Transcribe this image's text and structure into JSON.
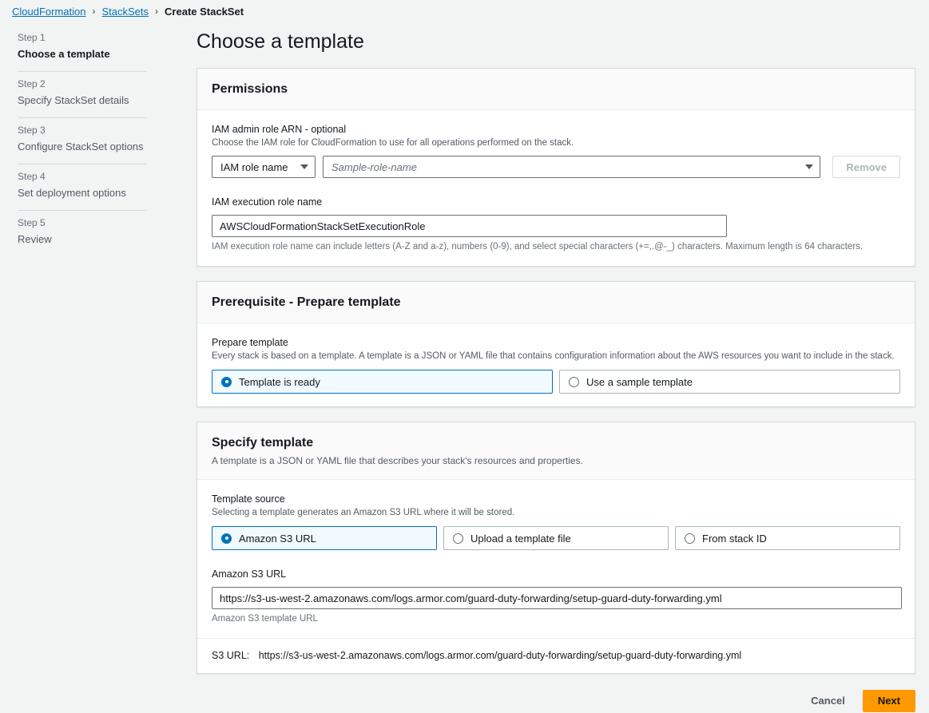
{
  "breadcrumb": {
    "items": [
      {
        "label": "CloudFormation",
        "type": "link"
      },
      {
        "label": "StackSets",
        "type": "link"
      },
      {
        "label": "Create StackSet",
        "type": "current"
      }
    ],
    "separator": "›"
  },
  "sidebar": {
    "steps": [
      {
        "num": "Step 1",
        "title": "Choose a template",
        "active": true
      },
      {
        "num": "Step 2",
        "title": "Specify StackSet details",
        "active": false
      },
      {
        "num": "Step 3",
        "title": "Configure StackSet options",
        "active": false
      },
      {
        "num": "Step 4",
        "title": "Set deployment options",
        "active": false
      },
      {
        "num": "Step 5",
        "title": "Review",
        "active": false
      }
    ]
  },
  "page": {
    "title": "Choose a template"
  },
  "permissions": {
    "header": "Permissions",
    "admin_role": {
      "label": "IAM admin role ARN - optional",
      "description": "Choose the IAM role for CloudFormation to use for all operations performed on the stack.",
      "select_value": "IAM role name",
      "combo_placeholder": "Sample-role-name",
      "combo_value": "",
      "remove_label": "Remove"
    },
    "execution_role": {
      "label": "IAM execution role name",
      "value": "AWSCloudFormationStackSetExecutionRole",
      "hint": "IAM execution role name can include letters (A-Z and a-z), numbers (0-9), and select special characters (+=,.@-_) characters. Maximum length is 64 characters."
    }
  },
  "prerequisite": {
    "header": "Prerequisite - Prepare template",
    "field_label": "Prepare template",
    "field_description": "Every stack is based on a template. A template is a JSON or YAML file that contains configuration information about the AWS resources you want to include in the stack.",
    "options": [
      {
        "label": "Template is ready",
        "selected": true
      },
      {
        "label": "Use a sample template",
        "selected": false
      }
    ]
  },
  "specify_template": {
    "header": "Specify template",
    "header_description": "A template is a JSON or YAML file that describes your stack's resources and properties.",
    "source_label": "Template source",
    "source_description": "Selecting a template generates an Amazon S3 URL where it will be stored.",
    "options": [
      {
        "label": "Amazon S3 URL",
        "selected": true
      },
      {
        "label": "Upload a template file",
        "selected": false
      },
      {
        "label": "From stack ID",
        "selected": false
      }
    ],
    "s3_input_label": "Amazon S3 URL",
    "s3_input_value": "https://s3-us-west-2.amazonaws.com/logs.armor.com/guard-duty-forwarding/setup-guard-duty-forwarding.yml",
    "s3_input_hint": "Amazon S3 template URL",
    "s3_url_label": "S3 URL:",
    "s3_url_value": "https://s3-us-west-2.amazonaws.com/logs.armor.com/guard-duty-forwarding/setup-guard-duty-forwarding.yml"
  },
  "footer": {
    "cancel_label": "Cancel",
    "next_label": "Next"
  },
  "colors": {
    "link": "#0073bb",
    "accent_orange": "#ff9900",
    "selected_tile_bg": "#f1faff",
    "page_bg": "#f2f3f3"
  }
}
